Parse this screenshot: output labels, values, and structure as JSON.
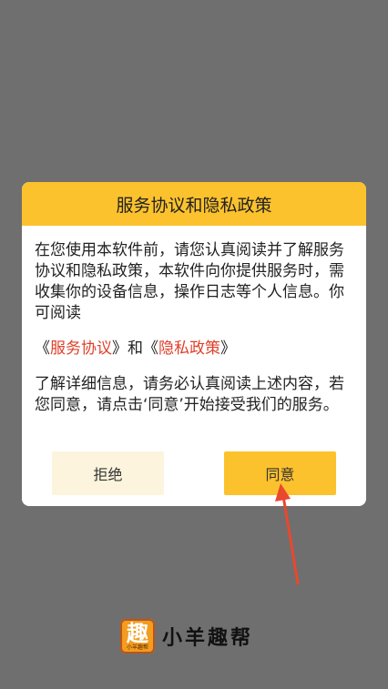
{
  "dialog": {
    "title": "服务协议和隐私政策",
    "paragraph1": "在您使用本软件前，请您认真阅读并了解服务协议和隐私政策，本软件向你提供服务时，需收集你的设备信息，操作日志等个人信息。你可阅读",
    "link_open_1": "《",
    "link_service": "服务协议",
    "link_close_1": "》",
    "link_and": "和",
    "link_open_2": "《",
    "link_privacy": "隐私政策",
    "link_close_2": "》",
    "paragraph2": "了解详细信息，请务必认真阅读上述内容，若您同意，请点击‘同意’开始接受我们的服务。",
    "reject_label": "拒绝",
    "agree_label": "同意"
  },
  "brand": {
    "logo_char": "趣",
    "logo_sub": "小羊趣帮",
    "name": "小羊趣帮",
    "logo_icon": "qu-logo-icon"
  },
  "colors": {
    "accent": "#fcc22d",
    "reject_bg": "#fdf4dd",
    "link": "#e0402b",
    "arrow": "#e8482e",
    "overlay": "#6f6f6f"
  }
}
